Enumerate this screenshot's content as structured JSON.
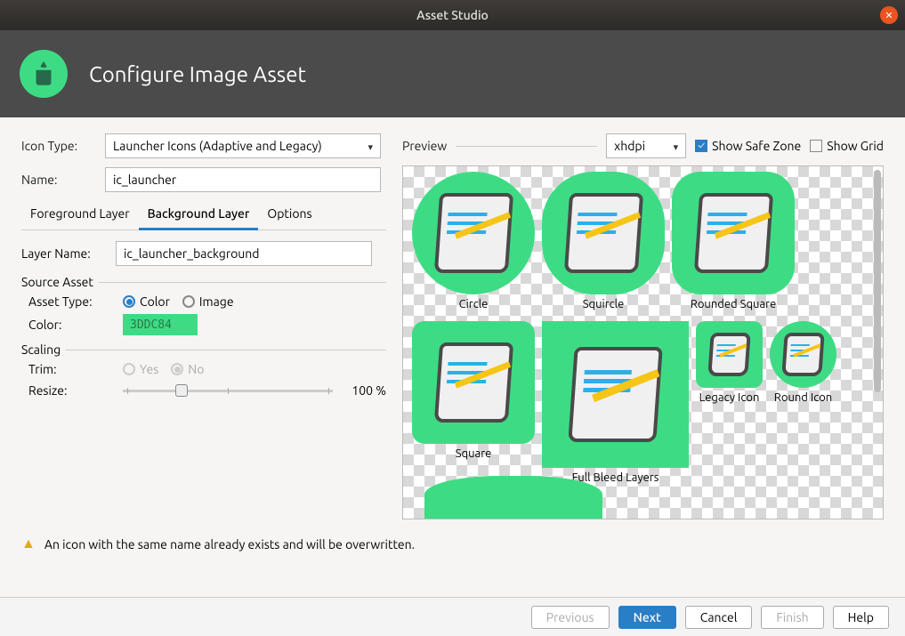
{
  "window": {
    "title": "Asset Studio"
  },
  "header": {
    "title": "Configure Image Asset"
  },
  "form": {
    "icon_type_label": "Icon Type:",
    "icon_type_value": "Launcher Icons (Adaptive and Legacy)",
    "name_label": "Name:",
    "name_value": "ic_launcher",
    "tabs": [
      {
        "label": "Foreground Layer",
        "active": false
      },
      {
        "label": "Background Layer",
        "active": true
      },
      {
        "label": "Options",
        "active": false
      }
    ],
    "layer_name_label": "Layer Name:",
    "layer_name_value": "ic_launcher_background",
    "source_asset_heading": "Source Asset",
    "asset_type_label": "Asset Type:",
    "asset_type_options": [
      {
        "label": "Color",
        "checked": true
      },
      {
        "label": "Image",
        "checked": false
      }
    ],
    "color_label": "Color:",
    "color_value": "3DDC84",
    "scaling_heading": "Scaling",
    "trim_label": "Trim:",
    "trim_options": [
      {
        "label": "Yes",
        "checked": false
      },
      {
        "label": "No",
        "checked": true
      }
    ],
    "resize_label": "Resize:",
    "resize_value": "100 %"
  },
  "preview": {
    "label": "Preview",
    "density": "xhdpi",
    "show_safe_zone": {
      "label": "Show Safe Zone",
      "checked": true
    },
    "show_grid": {
      "label": "Show Grid",
      "checked": false
    },
    "items": [
      {
        "label": "Circle"
      },
      {
        "label": "Squircle"
      },
      {
        "label": "Rounded Square"
      },
      {
        "label": "Square"
      },
      {
        "label": "Full Bleed Layers"
      },
      {
        "label": "Legacy Icon"
      },
      {
        "label": "Round Icon"
      }
    ]
  },
  "warning": "An icon with the same name already exists and will be overwritten.",
  "footer": {
    "previous": "Previous",
    "next": "Next",
    "cancel": "Cancel",
    "finish": "Finish",
    "help": "Help"
  }
}
